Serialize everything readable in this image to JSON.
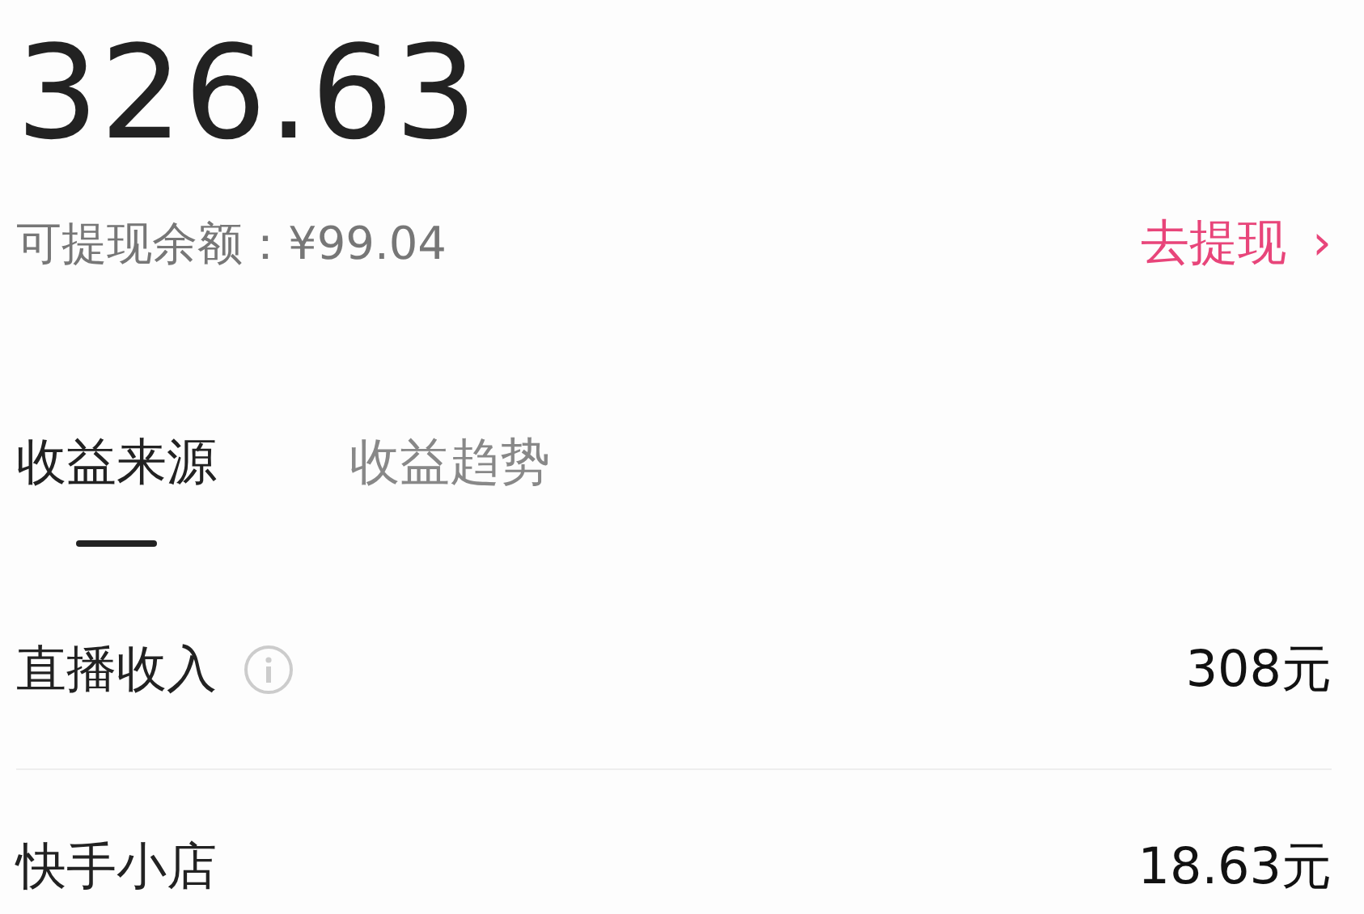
{
  "total": "326.63",
  "balance": {
    "label": "可提现余额：",
    "amount": "¥99.04"
  },
  "withdraw": {
    "label": "去提现",
    "arrow": "›"
  },
  "tabs": [
    {
      "label": "收益来源",
      "selected": true
    },
    {
      "label": "收益趋势",
      "selected": false
    }
  ],
  "rows": [
    {
      "label": "直播收入",
      "info": true,
      "value": "308元"
    },
    {
      "label": "快手小店",
      "info": false,
      "value": "18.63元"
    }
  ]
}
